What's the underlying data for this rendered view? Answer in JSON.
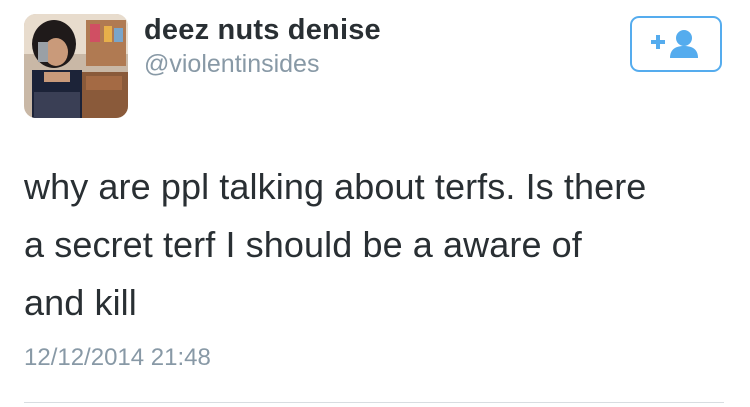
{
  "user": {
    "display_name": "deez nuts denise",
    "handle": "@violentinsides"
  },
  "follow_button": {
    "icon": "add-user-icon",
    "color": "#55acee"
  },
  "tweet": {
    "text_lines": [
      "why are ppl talking about terfs. Is there",
      "a secret terf I should be a aware of",
      "and kill"
    ],
    "timestamp": "12/12/2014 21:48"
  },
  "colors": {
    "text": "#292f33",
    "secondary": "#8899a6",
    "accent": "#55acee"
  }
}
